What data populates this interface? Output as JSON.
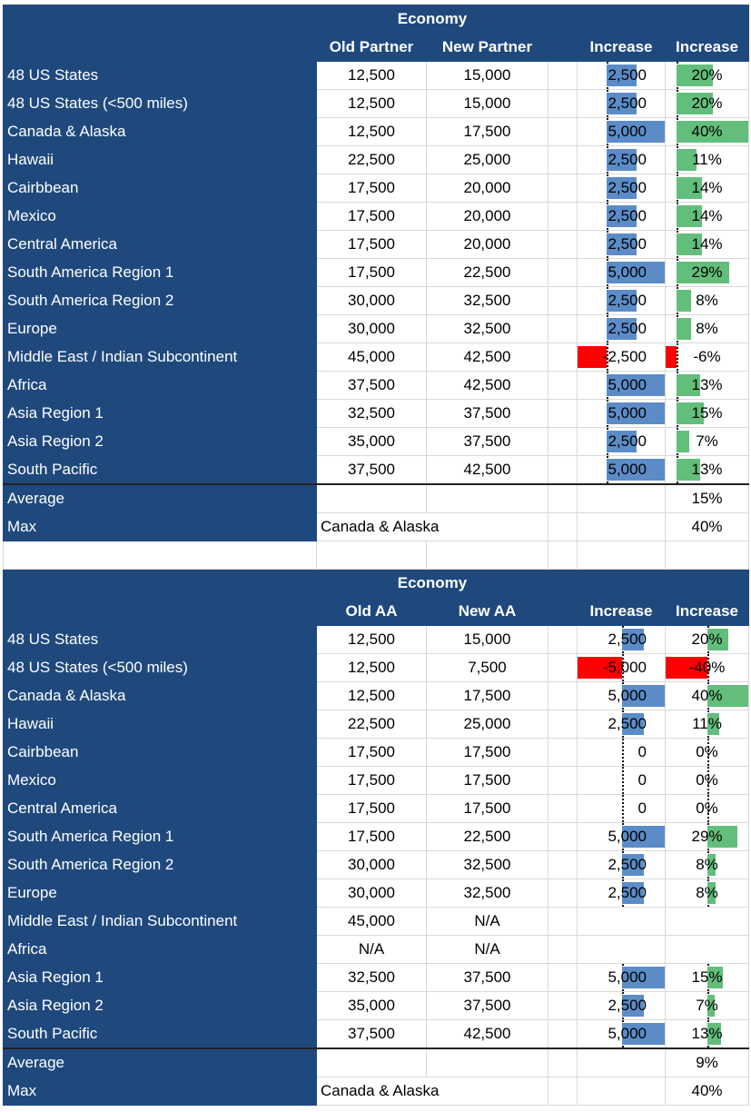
{
  "colors": {
    "header": "#1F497D",
    "bar_positive": "#5B8CC8",
    "pct_positive": "#63BE7B",
    "negative": "#FF0000"
  },
  "tables": [
    {
      "title": "Economy",
      "headers": [
        "Old Partner",
        "New Partner",
        "",
        "Increase",
        "Increase"
      ],
      "rows": [
        {
          "region": "48 US States",
          "old": "12,500",
          "new": "15,000",
          "inc": 2500,
          "inc_text": "2,500",
          "pct": 20,
          "pct_text": "20%"
        },
        {
          "region": "48 US States (<500 miles)",
          "old": "12,500",
          "new": "15,000",
          "inc": 2500,
          "inc_text": "2,500",
          "pct": 20,
          "pct_text": "20%"
        },
        {
          "region": "Canada & Alaska",
          "old": "12,500",
          "new": "17,500",
          "inc": 5000,
          "inc_text": "5,000",
          "pct": 40,
          "pct_text": "40%"
        },
        {
          "region": "Hawaii",
          "old": "22,500",
          "new": "25,000",
          "inc": 2500,
          "inc_text": "2,500",
          "pct": 11,
          "pct_text": "11%"
        },
        {
          "region": "Cairbbean",
          "old": "17,500",
          "new": "20,000",
          "inc": 2500,
          "inc_text": "2,500",
          "pct": 14,
          "pct_text": "14%"
        },
        {
          "region": "Mexico",
          "old": "17,500",
          "new": "20,000",
          "inc": 2500,
          "inc_text": "2,500",
          "pct": 14,
          "pct_text": "14%"
        },
        {
          "region": "Central America",
          "old": "17,500",
          "new": "20,000",
          "inc": 2500,
          "inc_text": "2,500",
          "pct": 14,
          "pct_text": "14%"
        },
        {
          "region": "South America Region 1",
          "old": "17,500",
          "new": "22,500",
          "inc": 5000,
          "inc_text": "5,000",
          "pct": 29,
          "pct_text": "29%"
        },
        {
          "region": "South America Region 2",
          "old": "30,000",
          "new": "32,500",
          "inc": 2500,
          "inc_text": "2,500",
          "pct": 8,
          "pct_text": "8%"
        },
        {
          "region": "Europe",
          "old": "30,000",
          "new": "32,500",
          "inc": 2500,
          "inc_text": "2,500",
          "pct": 8,
          "pct_text": "8%"
        },
        {
          "region": "Middle East / Indian Subcontinent",
          "old": "45,000",
          "new": "42,500",
          "inc": -2500,
          "inc_text": "-2,500",
          "pct": -6,
          "pct_text": "-6%"
        },
        {
          "region": "Africa",
          "old": "37,500",
          "new": "42,500",
          "inc": 5000,
          "inc_text": "5,000",
          "pct": 13,
          "pct_text": "13%"
        },
        {
          "region": "Asia Region 1",
          "old": "32,500",
          "new": "37,500",
          "inc": 5000,
          "inc_text": "5,000",
          "pct": 15,
          "pct_text": "15%"
        },
        {
          "region": "Asia Region 2",
          "old": "35,000",
          "new": "37,500",
          "inc": 2500,
          "inc_text": "2,500",
          "pct": 7,
          "pct_text": "7%"
        },
        {
          "region": "South Pacific",
          "old": "37,500",
          "new": "42,500",
          "inc": 5000,
          "inc_text": "5,000",
          "pct": 13,
          "pct_text": "13%"
        }
      ],
      "average_label": "Average",
      "average": "15%",
      "max_label": "Max",
      "max_region": "Canada & Alaska",
      "max": "40%"
    },
    {
      "title": "Economy",
      "headers": [
        "Old AA",
        "New AA",
        "",
        "Increase",
        "Increase"
      ],
      "rows": [
        {
          "region": "48 US States",
          "old": "12,500",
          "new": "15,000",
          "inc": 2500,
          "inc_text": "2,500",
          "pct": 20,
          "pct_text": "20%"
        },
        {
          "region": "48 US States (<500 miles)",
          "old": "12,500",
          "new": "7,500",
          "inc": -5000,
          "inc_text": "-5,000",
          "pct": -40,
          "pct_text": "-40%"
        },
        {
          "region": "Canada & Alaska",
          "old": "12,500",
          "new": "17,500",
          "inc": 5000,
          "inc_text": "5,000",
          "pct": 40,
          "pct_text": "40%"
        },
        {
          "region": "Hawaii",
          "old": "22,500",
          "new": "25,000",
          "inc": 2500,
          "inc_text": "2,500",
          "pct": 11,
          "pct_text": "11%"
        },
        {
          "region": "Cairbbean",
          "old": "17,500",
          "new": "17,500",
          "inc": 0,
          "inc_text": "0",
          "pct": 0,
          "pct_text": "0%"
        },
        {
          "region": "Mexico",
          "old": "17,500",
          "new": "17,500",
          "inc": 0,
          "inc_text": "0",
          "pct": 0,
          "pct_text": "0%"
        },
        {
          "region": "Central America",
          "old": "17,500",
          "new": "17,500",
          "inc": 0,
          "inc_text": "0",
          "pct": 0,
          "pct_text": "0%"
        },
        {
          "region": "South America Region 1",
          "old": "17,500",
          "new": "22,500",
          "inc": 5000,
          "inc_text": "5,000",
          "pct": 29,
          "pct_text": "29%"
        },
        {
          "region": "South America Region 2",
          "old": "30,000",
          "new": "32,500",
          "inc": 2500,
          "inc_text": "2,500",
          "pct": 8,
          "pct_text": "8%"
        },
        {
          "region": "Europe",
          "old": "30,000",
          "new": "32,500",
          "inc": 2500,
          "inc_text": "2,500",
          "pct": 8,
          "pct_text": "8%"
        },
        {
          "region": "Middle East / Indian Subcontinent",
          "old": "45,000",
          "new": "N/A",
          "inc": null,
          "inc_text": "",
          "pct": null,
          "pct_text": ""
        },
        {
          "region": "Africa",
          "old": "N/A",
          "new": "N/A",
          "inc": null,
          "inc_text": "",
          "pct": null,
          "pct_text": ""
        },
        {
          "region": "Asia Region 1",
          "old": "32,500",
          "new": "37,500",
          "inc": 5000,
          "inc_text": "5,000",
          "pct": 15,
          "pct_text": "15%"
        },
        {
          "region": "Asia Region 2",
          "old": "35,000",
          "new": "37,500",
          "inc": 2500,
          "inc_text": "2,500",
          "pct": 7,
          "pct_text": "7%"
        },
        {
          "region": "South Pacific",
          "old": "37,500",
          "new": "42,500",
          "inc": 5000,
          "inc_text": "5,000",
          "pct": 13,
          "pct_text": "13%"
        }
      ],
      "average_label": "Average",
      "average": "9%",
      "max_label": "Max",
      "max_region": "Canada & Alaska",
      "max": "40%"
    }
  ]
}
